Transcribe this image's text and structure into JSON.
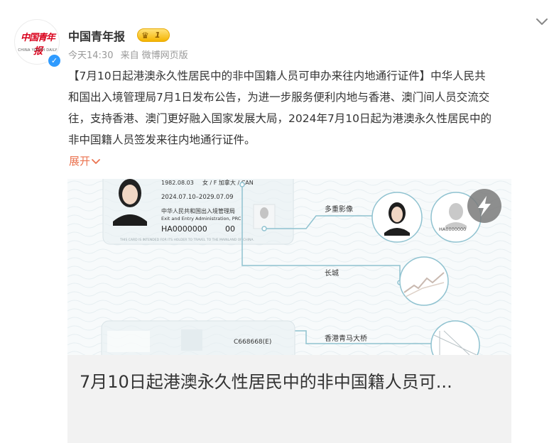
{
  "post": {
    "username": "中国青年报",
    "avatar_logo_cn": "中国青年报",
    "avatar_logo_en": "CHINA YOUTH DAILY",
    "vip_level": "1",
    "meta": {
      "time": "今天14:30",
      "source_prefix": "来自",
      "source": "微博网页版"
    },
    "text_lines": [
      "【7月10日起港澳永久性居民中的非中国籍人员可申办来往内地通行证件】中华人民共",
      "和国出入境管理局7月1日发布公告，为进一步服务便利内地与香港、澳门间人员交流交",
      "往，支持香港、澳门更好融入国家发展大局，2024年7月10日起为港澳永久性居民中的",
      "非中国籍人员签发来往内地通行证件。"
    ],
    "expand_label": "展开",
    "expand_icon": "chevron-down-icon",
    "more_icon": "chevron-down-icon"
  },
  "card": {
    "title": "7月10日起港澳永久性居民中的非中国籍人员可...",
    "play_icon": "lightning-icon",
    "image": {
      "birth_date": "1982.08.03",
      "sex_nationality": "女 / F   加拿大 / CAN",
      "validity": "2024.07.10–2029.07.09",
      "authority_cn": "中华人民共和国出入境管理局",
      "authority_en": "Exit and Entry Administration, PRC",
      "card_no": "HA0000000",
      "serial_no": "00",
      "card_notice": "THIS CARD IS INTENDED FOR ITS HOLDER TO TRAVEL TO THE MAINLAND OF CHINA.",
      "label_multi_image": "多重影像",
      "label_great_wall": "长城",
      "label_bridge": "香港青马大桥",
      "back_card_no": "C668668(E)",
      "small_card_no": "HA0000000"
    }
  }
}
